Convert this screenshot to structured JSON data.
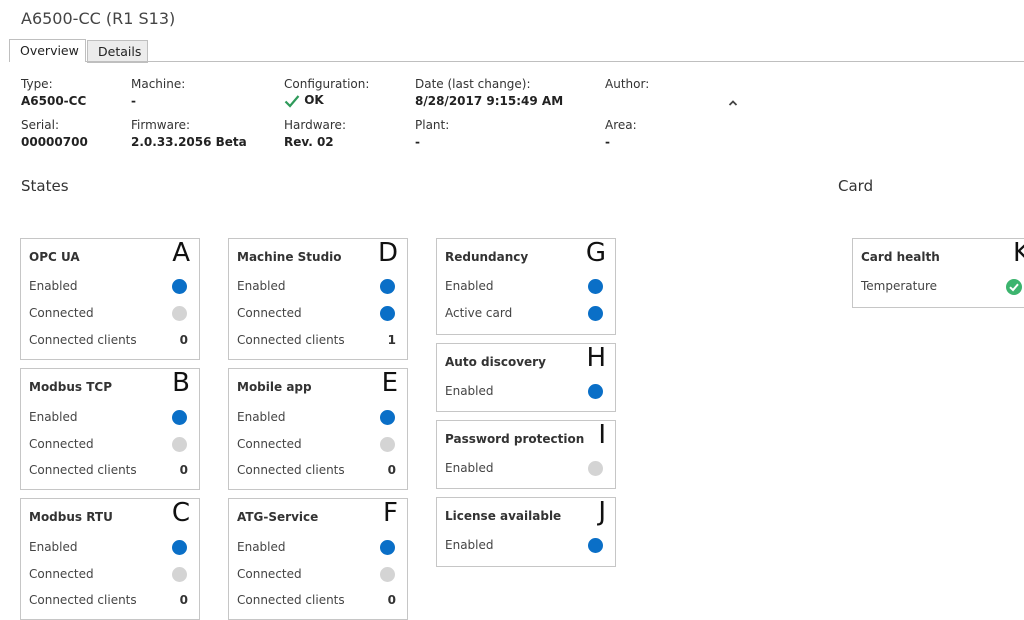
{
  "page": {
    "title": "A6500-CC (R1 S13)"
  },
  "tabs": [
    {
      "label": "Overview",
      "active": true
    },
    {
      "label": "Details",
      "active": false
    }
  ],
  "info": {
    "type_label": "Type:",
    "type_value": "A6500-CC",
    "machine_label": "Machine:",
    "machine_value": "-",
    "configuration_label": "Configuration:",
    "configuration_value": "OK",
    "date_label": "Date (last change):",
    "date_value": "8/28/2017 9:15:49 AM",
    "author_label": "Author:",
    "serial_label": "Serial:",
    "serial_value": "00000700",
    "firmware_label": "Firmware:",
    "firmware_value": "2.0.33.2056 Beta",
    "hardware_label": "Hardware:",
    "hardware_value": "Rev. 02",
    "plant_label": "Plant:",
    "plant_value": "-",
    "area_label": "Area:",
    "area_value": "-",
    "collapse_icon": "chevron-up-icon"
  },
  "sections": {
    "states": "States",
    "card": "Card"
  },
  "colors": {
    "enabled": "#0a6fc7",
    "disabled": "#d4d4d4",
    "ok": "#3cb46e"
  },
  "cards": {
    "opc_ua": {
      "title": "OPC UA",
      "letter": "A",
      "enabled": "Enabled",
      "connected": "Connected",
      "clients": "Connected clients",
      "clients_value": "0"
    },
    "modbus_tcp": {
      "title": "Modbus TCP",
      "letter": "B",
      "enabled": "Enabled",
      "connected": "Connected",
      "clients": "Connected clients",
      "clients_value": "0"
    },
    "modbus_rtu": {
      "title": "Modbus RTU",
      "letter": "C",
      "enabled": "Enabled",
      "connected": "Connected",
      "clients": "Connected clients",
      "clients_value": "0"
    },
    "machine_studio": {
      "title": "Machine Studio",
      "letter": "D",
      "enabled": "Enabled",
      "connected": "Connected",
      "clients": "Connected clients",
      "clients_value": "1"
    },
    "mobile_app": {
      "title": "Mobile app",
      "letter": "E",
      "enabled": "Enabled",
      "connected": "Connected",
      "clients": "Connected clients",
      "clients_value": "0"
    },
    "atg_service": {
      "title": "ATG-Service",
      "letter": "F",
      "enabled": "Enabled",
      "connected": "Connected",
      "clients": "Connected clients",
      "clients_value": "0"
    },
    "redundancy": {
      "title": "Redundancy",
      "letter": "G",
      "enabled": "Enabled",
      "active": "Active card"
    },
    "auto_discovery": {
      "title": "Auto discovery",
      "letter": "H",
      "enabled": "Enabled"
    },
    "password_protection": {
      "title": "Password protection",
      "letter": "I",
      "enabled": "Enabled"
    },
    "license_available": {
      "title": "License available",
      "letter": "J",
      "enabled": "Enabled"
    },
    "card_health": {
      "title": "Card health",
      "letter": "K",
      "temperature": "Temperature"
    }
  }
}
